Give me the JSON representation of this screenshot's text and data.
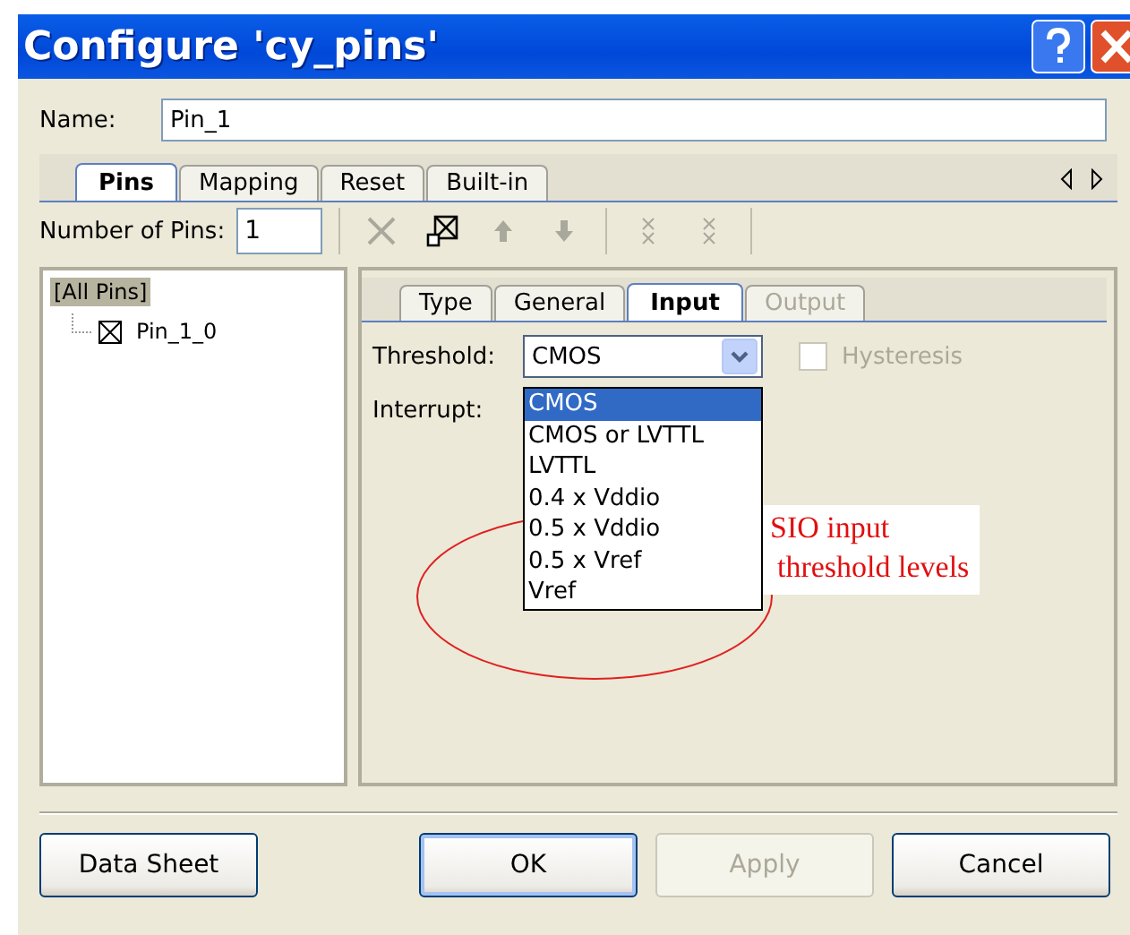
{
  "window": {
    "title": "Configure 'cy_pins'"
  },
  "name_field": {
    "label": "Name:",
    "value": "Pin_1"
  },
  "tabs": [
    {
      "label": "Pins",
      "selected": true
    },
    {
      "label": "Mapping",
      "selected": false
    },
    {
      "label": "Reset",
      "selected": false
    },
    {
      "label": "Built-in",
      "selected": false
    }
  ],
  "pin_count": {
    "label": "Number of Pins:",
    "value": "1"
  },
  "toolbar": [
    {
      "kind": "delete",
      "disabled": true
    },
    {
      "kind": "assign",
      "disabled": false
    },
    {
      "kind": "up",
      "disabled": true
    },
    {
      "kind": "down",
      "disabled": true
    },
    {
      "kind": "split",
      "disabled": true
    },
    {
      "kind": "merge",
      "disabled": true
    }
  ],
  "tree": {
    "label": "[All Pins]",
    "selected": true,
    "children": [
      {
        "label": "Pin_1_0",
        "selected": false
      }
    ]
  },
  "subtabs": [
    {
      "label": "Type",
      "selected": false,
      "disabled": false
    },
    {
      "label": "General",
      "selected": false,
      "disabled": false
    },
    {
      "label": "Input",
      "selected": true,
      "disabled": false
    },
    {
      "label": "Output",
      "selected": false,
      "disabled": true
    }
  ],
  "threshold": {
    "label": "Threshold:",
    "value": "CMOS",
    "expanded": true,
    "options": [
      {
        "label": "CMOS",
        "selected": true
      },
      {
        "label": "CMOS or LVTTL",
        "selected": false
      },
      {
        "label": "LVTTL",
        "selected": false
      },
      {
        "label": "0.4 x Vddio",
        "selected": false
      },
      {
        "label": "0.5 x Vddio",
        "selected": false
      },
      {
        "label": "0.5 x Vref",
        "selected": false
      },
      {
        "label": "Vref",
        "selected": false
      }
    ]
  },
  "hysteresis": {
    "label": "Hysteresis",
    "checked": false,
    "disabled": true
  },
  "interrupt": {
    "label": "Interrupt:"
  },
  "annotation": {
    "lines": [
      "SIO input",
      "threshold levels"
    ]
  },
  "buttons": [
    {
      "label": "Data Sheet",
      "disabled": false,
      "default": false
    },
    {
      "label": "OK",
      "disabled": false,
      "default": true
    },
    {
      "label": "Apply",
      "disabled": true,
      "default": false
    },
    {
      "label": "Cancel",
      "disabled": false,
      "default": false
    }
  ]
}
